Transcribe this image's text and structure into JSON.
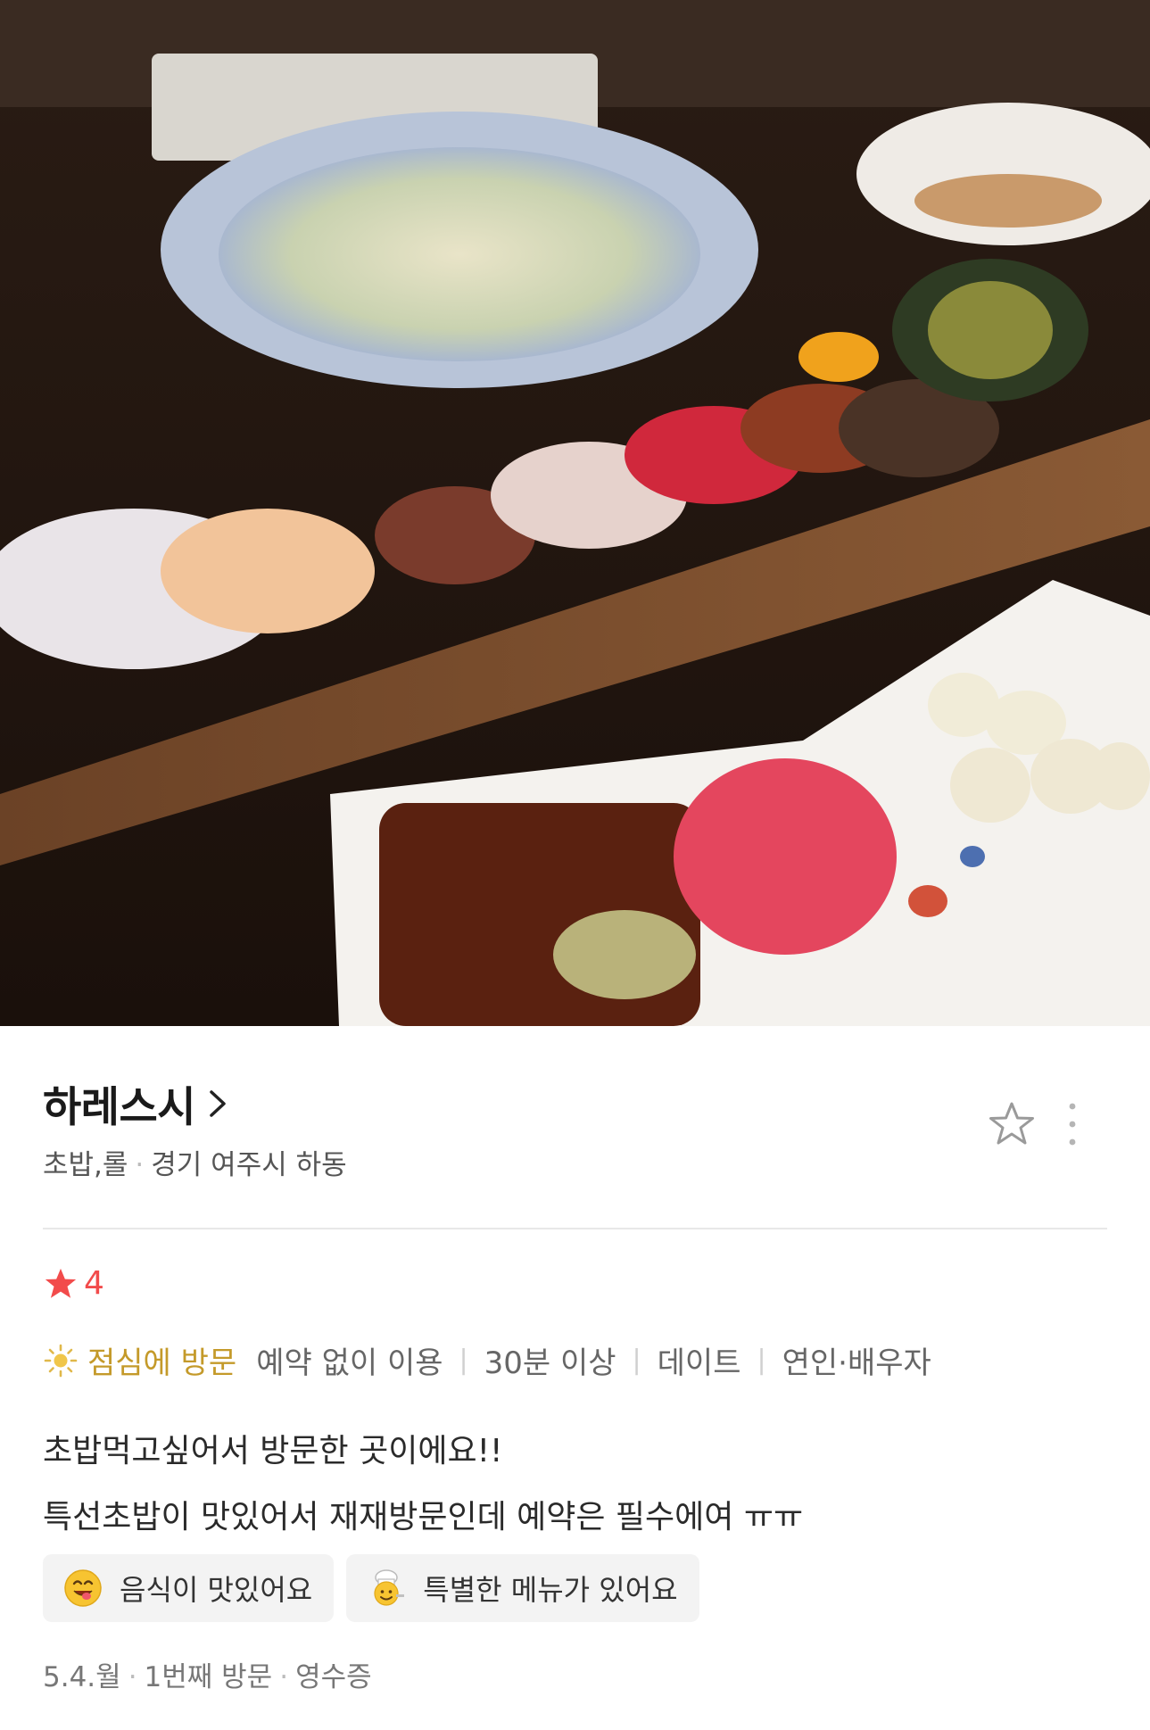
{
  "restaurant": {
    "name": "하레스시",
    "category": "초밥,롤",
    "location": "경기 여주시 하동"
  },
  "review": {
    "rating": "4",
    "visit_time": "점심에 방문",
    "tags": [
      "예약 없이 이용",
      "30분 이상",
      "데이트",
      "연인·배우자"
    ],
    "lines": [
      "초밥먹고싶어서 방문한 곳이에요!!",
      "특선초밥이 맛있어서 재재방문인데 예약은 필수에여 ㅠㅠ"
    ],
    "keywords": [
      {
        "label": "음식이 맛있어요",
        "icon": "yummy-face-icon"
      },
      {
        "label": "특별한 메뉴가 있어요",
        "icon": "chef-icon"
      }
    ],
    "footer": {
      "date": "5.4.월",
      "visit_count": "1번째 방문",
      "verification": "영수증"
    }
  },
  "colors": {
    "rating_star": "#f24b4b",
    "visit_time": "#c49a2a",
    "chip_bg": "#f3f3f3",
    "divider": "#e8e8e8"
  }
}
